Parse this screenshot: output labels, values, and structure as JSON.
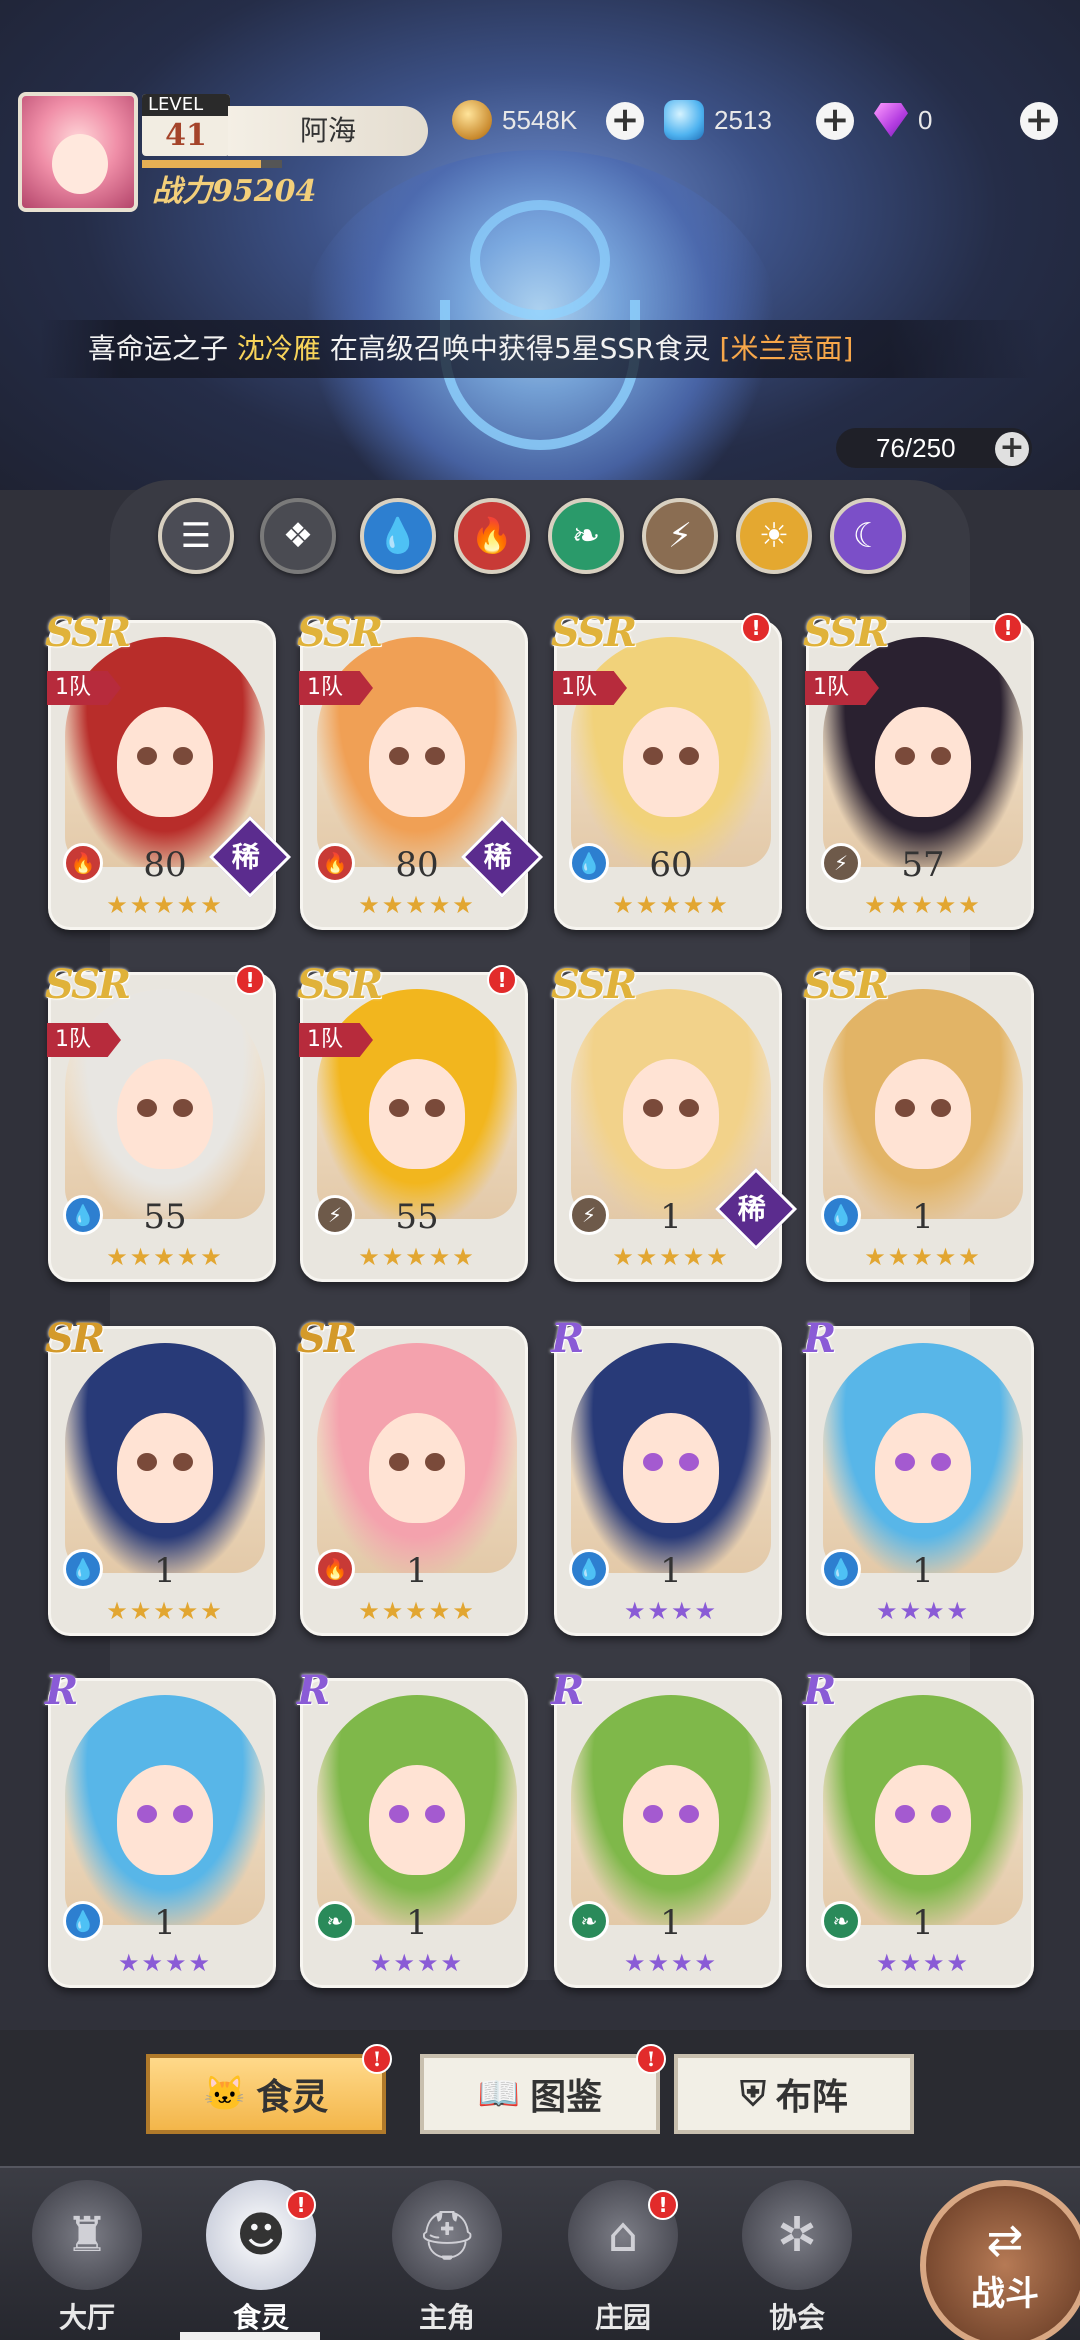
{
  "header": {
    "level_label": "LEVEL",
    "level": "41",
    "player_name": "阿海",
    "power": "战力95204",
    "exp_fraction": 0.85,
    "coins": "5548K",
    "gems": "2513",
    "diamonds": "0"
  },
  "announcement": {
    "prefix": "喜命运之子 ",
    "player": "沈冷雁",
    "middle": " 在高级召唤中获得5星SSR食灵 ",
    "reward": "[米兰意面]"
  },
  "inventory": {
    "count": "76/250"
  },
  "filters": [
    {
      "name": "filter-all",
      "glyph": "☰",
      "color": "#4b4c55"
    },
    {
      "name": "filter-ground",
      "glyph": "❖",
      "color": "#4b4c55"
    },
    {
      "name": "filter-water",
      "glyph": "💧",
      "color": "#2d7fd0"
    },
    {
      "name": "filter-fire",
      "glyph": "🔥",
      "color": "#c83a36"
    },
    {
      "name": "filter-wind",
      "glyph": "❧",
      "color": "#2a9a6a"
    },
    {
      "name": "filter-thunder",
      "glyph": "⚡",
      "color": "#8a6d52"
    },
    {
      "name": "filter-light",
      "glyph": "☀",
      "color": "#e4a830"
    },
    {
      "name": "filter-dark",
      "glyph": "☾",
      "color": "#7b4fc8"
    }
  ],
  "cards": [
    {
      "rarity": "SSR",
      "team": "1队",
      "alert": false,
      "element": "fire",
      "level": "80",
      "rare": "稀",
      "stars": "★★★★★",
      "star_color": "gold",
      "hair": "#b82d2a"
    },
    {
      "rarity": "SSR",
      "team": "1队",
      "alert": false,
      "element": "fire",
      "level": "80",
      "rare": "稀",
      "stars": "★★★★★",
      "star_color": "gold",
      "hair": "#f0a055"
    },
    {
      "rarity": "SSR",
      "team": "1队",
      "alert": true,
      "element": "water",
      "level": "60",
      "rare": "",
      "stars": "★★★★★",
      "star_color": "gold",
      "hair": "#f1d27a"
    },
    {
      "rarity": "SSR",
      "team": "1队",
      "alert": true,
      "element": "thunder",
      "level": "57",
      "rare": "",
      "stars": "★★★★★",
      "star_color": "gold",
      "hair": "#2a2130"
    },
    {
      "rarity": "SSR",
      "team": "1队",
      "alert": true,
      "element": "water",
      "level": "55",
      "rare": "",
      "stars": "★★★★★",
      "star_color": "gold",
      "hair": "#e8e6e2"
    },
    {
      "rarity": "SSR",
      "team": "1队",
      "alert": true,
      "element": "thunder",
      "level": "55",
      "rare": "",
      "stars": "★★★★★",
      "star_color": "gold",
      "hair": "#f2b61e"
    },
    {
      "rarity": "SSR",
      "team": "",
      "alert": false,
      "element": "thunder",
      "level": "1",
      "rare": "稀",
      "stars": "★★★★★",
      "star_color": "gold",
      "hair": "#f2d28a"
    },
    {
      "rarity": "SSR",
      "team": "",
      "alert": false,
      "element": "water",
      "level": "1",
      "rare": "",
      "stars": "★★★★★",
      "star_color": "gold",
      "hair": "#e2b466"
    },
    {
      "rarity": "SR",
      "team": "",
      "alert": false,
      "element": "water",
      "level": "1",
      "rare": "",
      "stars": "★★★★★",
      "star_color": "gold",
      "hair": "#283a78"
    },
    {
      "rarity": "SR",
      "team": "",
      "alert": false,
      "element": "fire",
      "level": "1",
      "rare": "",
      "stars": "★★★★★",
      "star_color": "gold",
      "hair": "#f4a2ad"
    },
    {
      "rarity": "R",
      "team": "",
      "alert": false,
      "element": "water",
      "level": "1",
      "rare": "",
      "stars": "★★★★",
      "star_color": "purple",
      "hair": "#283a78"
    },
    {
      "rarity": "R",
      "team": "",
      "alert": false,
      "element": "water",
      "level": "1",
      "rare": "",
      "stars": "★★★★",
      "star_color": "purple",
      "hair": "#58b6e8"
    },
    {
      "rarity": "R",
      "team": "",
      "alert": false,
      "element": "water",
      "level": "1",
      "rare": "",
      "stars": "★★★★",
      "star_color": "purple",
      "hair": "#58b6e8"
    },
    {
      "rarity": "R",
      "team": "",
      "alert": false,
      "element": "wind",
      "level": "1",
      "rare": "",
      "stars": "★★★★",
      "star_color": "purple",
      "hair": "#7fb84a"
    },
    {
      "rarity": "R",
      "team": "",
      "alert": false,
      "element": "wind",
      "level": "1",
      "rare": "",
      "stars": "★★★★",
      "star_color": "purple",
      "hair": "#7fb84a"
    },
    {
      "rarity": "R",
      "team": "",
      "alert": false,
      "element": "wind",
      "level": "1",
      "rare": "",
      "stars": "★★★★",
      "star_color": "purple",
      "hair": "#7fb84a"
    }
  ],
  "element_colors": {
    "fire": "#c83a36",
    "water": "#2d7fd0",
    "thunder": "#6e5a4a",
    "wind": "#2a8a5a"
  },
  "element_glyphs": {
    "fire": "🔥",
    "water": "💧",
    "thunder": "⚡",
    "wind": "❧"
  },
  "subtabs": [
    {
      "label": "食灵",
      "icon": "cat-icon",
      "glyph": "🐱",
      "active": true,
      "alert": true
    },
    {
      "label": "图鉴",
      "icon": "book-icon",
      "glyph": "📖",
      "active": false,
      "alert": true
    },
    {
      "label": "布阵",
      "icon": "formation-icon",
      "glyph": "⛨",
      "active": false,
      "alert": false
    }
  ],
  "nav": [
    {
      "label": "大厅",
      "icon": "castle-icon",
      "glyph": "♜",
      "active": false,
      "alert": false
    },
    {
      "label": "食灵",
      "icon": "cat-icon",
      "glyph": "☻",
      "active": true,
      "alert": true
    },
    {
      "label": "主角",
      "icon": "helmet-icon",
      "glyph": "⛑",
      "active": false,
      "alert": false
    },
    {
      "label": "庄园",
      "icon": "house-icon",
      "glyph": "⌂",
      "active": false,
      "alert": true
    },
    {
      "label": "协会",
      "icon": "shield-icon",
      "glyph": "✲",
      "active": false,
      "alert": false
    }
  ],
  "battle": {
    "label": "战斗",
    "glyph": "⇄"
  },
  "alert_mark": "!",
  "plus_mark": "+"
}
